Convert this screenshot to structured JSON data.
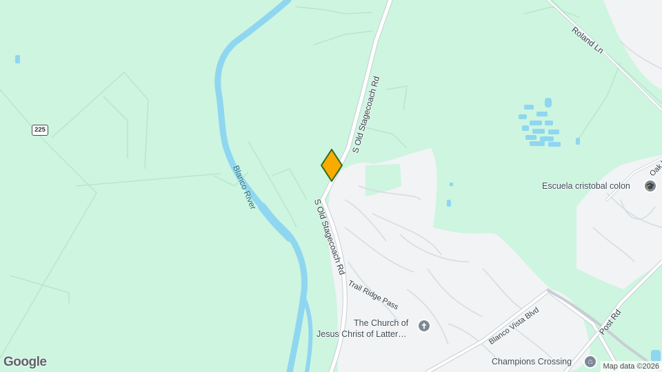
{
  "map": {
    "route_shield": "225",
    "roads": {
      "stagecoach_upper": "S Old Stagecoach Rd",
      "stagecoach_lower": "S Old Stagecoach Rd",
      "roland": "Roland Ln",
      "trail_ridge": "Trail Ridge Pass",
      "blanco_vista": "Blanco Vista Blvd",
      "post": "Post Rd",
      "oak_hill": "Oak Hill"
    },
    "river": "Blanco River",
    "pois": {
      "school": "Escuela cristobal colon",
      "church_line1": "The Church of",
      "church_line2": "Jesus Christ of Latter…",
      "champions": "Champions Crossing"
    },
    "branding": {
      "logo": "Google",
      "attribution": "Map data ©2026"
    },
    "colors": {
      "park": "#cdf5e0",
      "urban": "#f1f3f4",
      "water": "#8fd6f0",
      "road": "#ffffff",
      "marker": "#f9ab00",
      "marker_outline": "#2e6a1e"
    },
    "icons": {
      "school": "graduation-cap-icon",
      "church": "cross-icon",
      "champions": "landmark-icon",
      "marker": "location-marker-icon"
    }
  }
}
